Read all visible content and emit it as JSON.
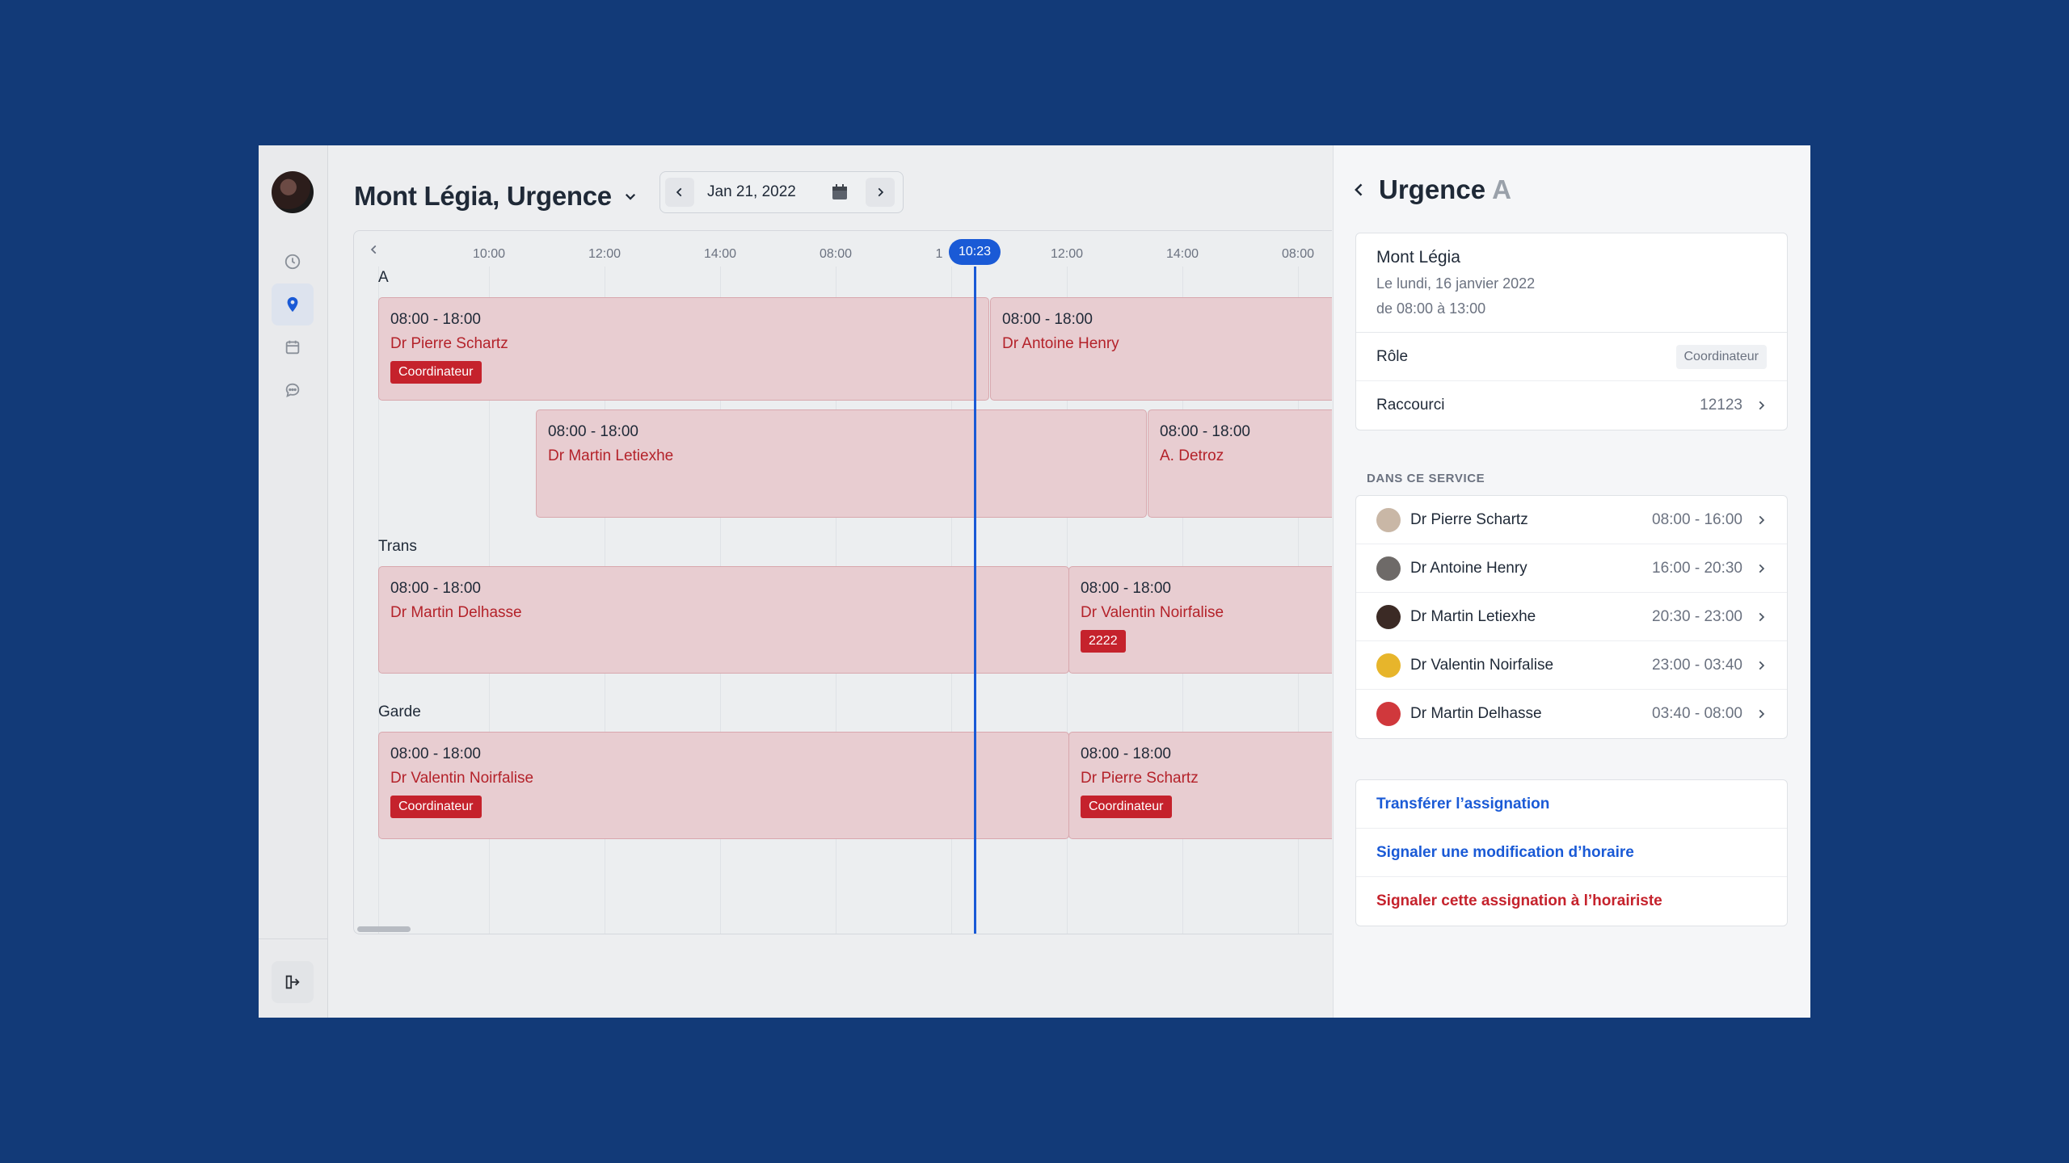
{
  "colors": {
    "background": "#123a78",
    "accent": "#1a5ad6",
    "shift_bg": "#e8cdd1",
    "badge": "#c5222c",
    "danger_text": "#c5222c"
  },
  "rail": {
    "items": [
      {
        "icon": "clock-icon"
      },
      {
        "icon": "location-pin-icon",
        "active": true
      },
      {
        "icon": "calendar-icon"
      },
      {
        "icon": "chat-bubble-icon"
      }
    ],
    "logout_icon": "logout-icon"
  },
  "header": {
    "title": "Mont Légia, Urgence",
    "date": "Jan 21, 2022"
  },
  "timeline": {
    "ticks": [
      "10:00",
      "12:00",
      "14:00",
      "08:00",
      "1",
      "12:00",
      "14:00",
      "08:00"
    ],
    "now_label": "10:23",
    "groups": [
      {
        "label": "A"
      },
      {
        "label": "Trans"
      },
      {
        "label": "Garde"
      }
    ],
    "shifts": [
      {
        "time": "08:00 - 18:00",
        "name": "Dr Pierre Schartz",
        "badge": "Coordinateur"
      },
      {
        "time": "08:00 - 18:00",
        "name": "Dr Antoine Henry",
        "badge": ""
      },
      {
        "time": "08:00 - 18:00",
        "name": "Dr Martin Letiexhe",
        "badge": ""
      },
      {
        "time": "08:00 - 18:00",
        "name": "A. Detroz",
        "badge": ""
      },
      {
        "time": "08:00 - 18:00",
        "name": "Dr Martin Delhasse",
        "badge": ""
      },
      {
        "time": "08:00 - 18:00",
        "name": "Dr Valentin Noirfalise",
        "badge": "2222"
      },
      {
        "time": "08:00 - 18:00",
        "name": "Dr Valentin Noirfalise",
        "badge": "Coordinateur"
      },
      {
        "time": "08:00 - 18:00",
        "name": "Dr Pierre Schartz",
        "badge": "Coordinateur"
      }
    ]
  },
  "panel": {
    "title": "Urgence",
    "title_suffix": "A",
    "info": {
      "location": "Mont Légia",
      "date_line": "Le lundi, 16 janvier 2022",
      "time_line": "de 08:00 à 13:00"
    },
    "role_label": "Rôle",
    "role_value": "Coordinateur",
    "shortcut_label": "Raccourci",
    "shortcut_value": "12123",
    "section_title": "DANS CE SERVICE",
    "people": [
      {
        "name": "Dr Pierre Schartz",
        "hours": "08:00 - 16:00",
        "avatar_color": "#c9b7a6"
      },
      {
        "name": "Dr Antoine Henry",
        "hours": "16:00 - 20:30",
        "avatar_color": "#6e6a68"
      },
      {
        "name": "Dr Martin Letiexhe",
        "hours": "20:30 - 23:00",
        "avatar_color": "#3b2a25"
      },
      {
        "name": "Dr Valentin Noirfalise",
        "hours": "23:00 - 03:40",
        "avatar_color": "#e7b52b"
      },
      {
        "name": "Dr Martin Delhasse",
        "hours": "03:40 - 08:00",
        "avatar_color": "#d0383c"
      }
    ],
    "actions": [
      {
        "label": "Transférer l’assignation",
        "color": "#1a5ad6"
      },
      {
        "label": "Signaler une modification d’horaire",
        "color": "#1a5ad6"
      },
      {
        "label": "Signaler cette assignation à l’horairiste",
        "color": "#c5222c"
      }
    ]
  }
}
